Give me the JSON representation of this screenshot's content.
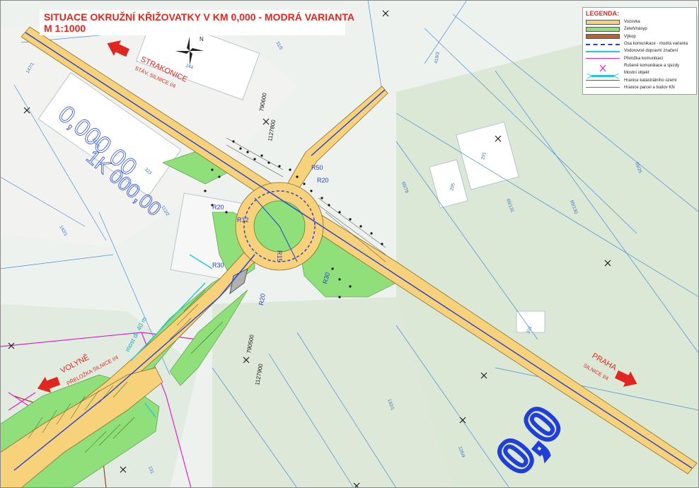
{
  "title": {
    "line1": "SITUACE OKRUŽNÍ KŘIŽOVATKY V KM 0,000 - MODRÁ VARIANTA",
    "line2": "M 1:1000"
  },
  "legend": {
    "title": "LEGENDA:",
    "items": [
      {
        "label": "Vozovka",
        "color": "#f8d27a"
      },
      {
        "label": "Zeleň/násyp",
        "color": "#8fe07a"
      },
      {
        "label": "Výkop",
        "color": "#c0602a"
      },
      {
        "label": "Osa komunikace - modrá varianta",
        "color": "#1f3fd6"
      },
      {
        "label": "Vodorovné dopravní značení",
        "color": "#21c8e0"
      },
      {
        "label": "Přeložka komunikací",
        "color": "#e020c8"
      },
      {
        "label": "Rušené komunikace a sjezdy",
        "color": "#e020c8"
      },
      {
        "label": "Mostní objekt",
        "color": "#21c8e0"
      },
      {
        "label": "Hranice katastrálního území",
        "color": "#a0402a"
      },
      {
        "label": "Hranice parcel a budov KN",
        "color": "#2a86d6"
      }
    ]
  },
  "directions": {
    "strakonice": "STRAKONICE",
    "strakonice_sub": "STÁV. SILNICE I/4",
    "volyne": "VOLYNĚ",
    "volyne_sub": "PŘELOŽKA SILNICE I/4",
    "praha": "PRAHA",
    "praha_sub": "SILNICE I/4"
  },
  "coords": {
    "c1": "790600",
    "c2": "1127800",
    "c3": "790500",
    "c4": "1127900"
  },
  "radii": {
    "r50": "R50",
    "r20a": "R20",
    "r20b": "R20",
    "r12": "R12",
    "r15": "R15",
    "r30a": "R30",
    "r30b": "R30",
    "r20c": "R20"
  },
  "station_text": "0,000 00",
  "station_text2": "1K 000,00",
  "big_label": "0,0",
  "bridge_note": "most dl. 40 m",
  "parcels": {
    "p244": "244",
    "p323": "323",
    "p291": "291",
    "p205": "205",
    "p331": "331",
    "p112_5": "112/5",
    "p112_2": "112/2",
    "p65_78": "65/78",
    "p65_131": "65/131",
    "p65_130": "65/130",
    "p65_25": "65/25",
    "p419_3": "419/3",
    "p132_1": "132/1",
    "p126_4": "126/4",
    "p131": "131",
    "p147_1": "147/1",
    "p31_5": "31/5",
    "p142_1": "142/1"
  },
  "colors": {
    "road": "#f8d27a",
    "green": "#8fe07a",
    "axis": "#1f3fd6",
    "cyan": "#21c8e0",
    "magenta": "#e020c8",
    "red": "#e0261f",
    "boundary": "#a0402a",
    "parcel": "#4a8fd6"
  },
  "icons": [
    "north-arrow-icon",
    "direction-arrow-icon",
    "grid-cross-icon"
  ]
}
